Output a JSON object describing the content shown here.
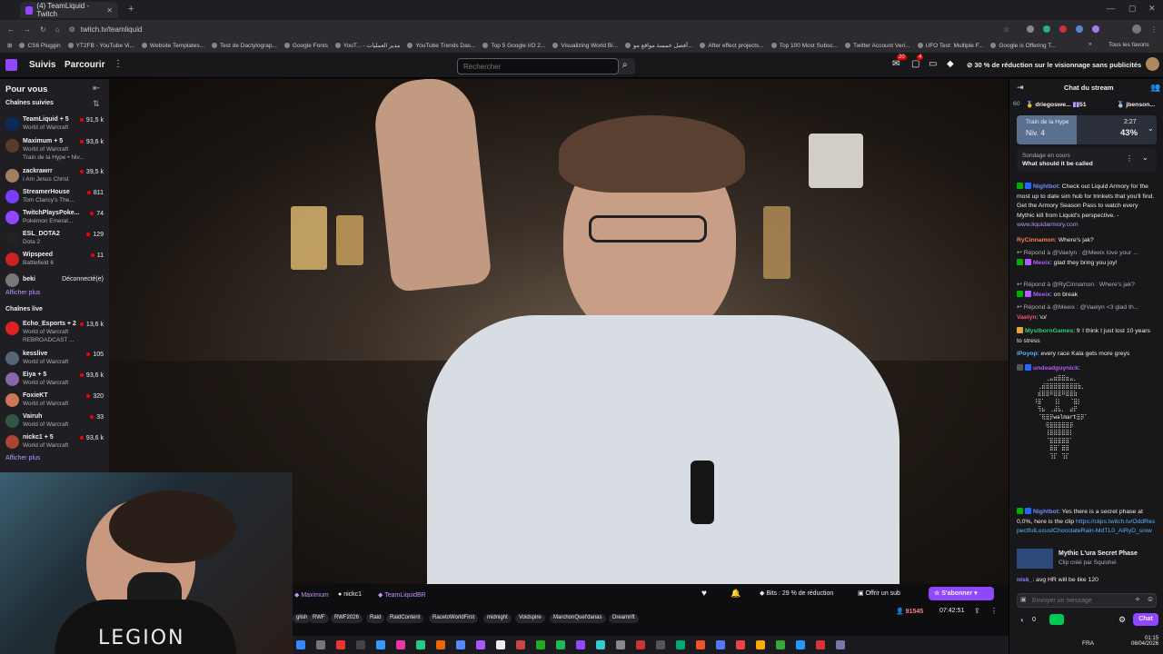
{
  "browser": {
    "tab_title": "(4) TeamLiquid - Twitch",
    "url": "twitch.tv/teamliquid",
    "bookmarks": [
      "CS6 Pluggin",
      "YT2FB - YouTube Vi...",
      "Website Templates...",
      "Test de Dactylograp...",
      "Google Fonts",
      "YouT... - مدير العمليات",
      "YouTube Trends Das...",
      "Top 5 Google I/O 2...",
      "Visualizing World Bi...",
      "أفضل خمسة مواقع مو...",
      "After effect projects...",
      "Top 100 Most Subsc...",
      "Twitter Account Veri...",
      "UFO Test: Multiple F...",
      "Google is Offering T..."
    ],
    "all_favorites": "Tous les favoris"
  },
  "nav": {
    "suivis": "Suivis",
    "parcourir": "Parcourir",
    "search_placeholder": "Rechercher",
    "notif_count1": "20",
    "notif_count2": "4",
    "promo": "30 % de réduction sur le visionnage sans publicités"
  },
  "sidebar": {
    "pour_vous": "Pour vous",
    "followed_heading": "Chaînes suivies",
    "followed": [
      {
        "name": "TeamLiquid + 5",
        "game": "World of Warcraft",
        "viewers": "91,5 k",
        "color": "#0a2a5a"
      },
      {
        "name": "Maximum + 5",
        "game": "World of Warcraft",
        "extra": "Train de la Hype • Niv...",
        "viewers": "93,6 k",
        "color": "#5a3a2a"
      },
      {
        "name": "zackrawrr",
        "game": "I Am Jesus Christ",
        "viewers": "39,5 k",
        "color": "#a08060"
      },
      {
        "name": "StreamerHouse",
        "game": "Tom Clancy's The...",
        "viewers": "811",
        "color": "#7a3cff"
      },
      {
        "name": "TwitchPlaysPoke...",
        "game": "Pokémon Emeral...",
        "viewers": "74",
        "color": "#9146ff"
      },
      {
        "name": "ESL_DOTA2",
        "game": "Dota 2",
        "viewers": "129",
        "color": "#222222"
      },
      {
        "name": "Wipspeed",
        "game": "Battlefield 6",
        "viewers": "11",
        "color": "#cc2222"
      },
      {
        "name": "beki",
        "status": "Déconnecté(e)",
        "color": "#777777"
      }
    ],
    "show_more_1": "Afficher plus",
    "live_heading": "Chaînes live",
    "live": [
      {
        "name": "Echo_Esports + 2",
        "game": "World of Warcraft",
        "extra": "REBROADCAST ...",
        "viewers": "13,6 k",
        "color": "#dd2222"
      },
      {
        "name": "kesslive",
        "game": "World of Warcraft",
        "viewers": "105",
        "color": "#556677"
      },
      {
        "name": "Eiya + 5",
        "game": "World of Warcraft",
        "viewers": "93,6 k",
        "color": "#8866aa"
      },
      {
        "name": "FoxieKT",
        "game": "World of Warcraft",
        "viewers": "320",
        "color": "#cc7755"
      },
      {
        "name": "Vairuh",
        "game": "World of Warcraft",
        "viewers": "33",
        "color": "#335544"
      },
      {
        "name": "nickc1 + 5",
        "game": "World of Warcraft",
        "viewers": "93,6 k",
        "color": "#aa4433"
      }
    ],
    "show_more_2": "Afficher plus"
  },
  "webcam": {
    "logo_text": "LEGION"
  },
  "stream": {
    "collab": [
      "Maximum",
      "nickc1",
      "TeamLiquidBR"
    ],
    "tags": [
      "glish",
      "RWF",
      "RWF2026",
      "Raid",
      "RaidContent",
      "RacetoWorldFirst",
      "midnight",
      "Voidspire",
      "MarchonQuel'danas",
      "Dreamrift"
    ],
    "bits": "Bits : 29 % de réduction",
    "gift": "Offrir un sub",
    "subscribe": "S'abonner",
    "viewers": "91545",
    "uptime": "07:42:51"
  },
  "chat": {
    "title": "Chat du stream",
    "top_count": "60",
    "top_users": [
      {
        "name": "driegoswe...",
        "count": "51"
      },
      {
        "name": "jbenson..."
      }
    ],
    "hype": {
      "label": "Train de la Hype",
      "level": "Niv. 4",
      "time": "2:27",
      "percent": "43%"
    },
    "poll": {
      "label": "Sondage en cours",
      "question": "What should it be called"
    },
    "messages": [
      {
        "user": "Nightbot",
        "color": "#6d8cff",
        "text": "Check out Liquid Armory for the most up to date sim hub for trinkets that you'll find. Get the Armory Season Pass to watch every Mythic kill from Liquid's perspective. - ",
        "link": "www.liquidarmory.com"
      },
      {
        "user": "RyCinnamon",
        "color": "#ff7f50",
        "text": "Where's jak?"
      },
      {
        "reply": "Répond à @Vaelyn : @Meeix love your ...",
        "user": "Meeix",
        "color": "#b05cff",
        "text": "glad they bring you joy!"
      },
      {
        "reply": "Répond à @RyCinnamon : Where's jak?",
        "user": "Meeix",
        "color": "#b05cff",
        "text": "on break"
      },
      {
        "reply": "Répond à @Meeix : @Vaelyn <3 glad th...",
        "user": "Vaelyn",
        "color": "#ff4f6e",
        "text": "\\o/"
      },
      {
        "user": "MystbornGames",
        "color": "#2ecc71",
        "text": "fr I think I just lost 10 years to stress"
      },
      {
        "user": "iPoyop",
        "color": "#5ab4ff",
        "text": "every race Kala gets more greys"
      },
      {
        "user": "undeadguynick",
        "color": "#b05cff",
        "text": ""
      },
      {
        "user": "Nightbot",
        "color": "#6d8cff",
        "text": "Yes there is a secret phase at 0,0%, here is the clip ",
        "link": "https://clips.twitch.tv/OddRespectfulLocustChocolateRain-MdTL0_AiRyD_srxw"
      },
      {
        "user": "nisk_",
        "color": "#8a8aff",
        "text": "avg HR will be like 120"
      }
    ],
    "ascii_art": "⠀⠀⠀⠀⢀⣤⣶⣿⣿⣶⣤⡀⠀\n⠀⠀⢀⣾⣿⣿⣿⣿⣿⣿⣿⣿⣷⡀\n⠀⠀⣾⣿⣿⠿⣿⣿⠿⣿⣿⣷⠀\n⠀⠸⣿⠁⠀⠀⢸⡇⠀⠀⠈⣿⡇\n⠀⠀⢻⣦⠀⢀⣼⣧⡀⠀⣴⡟⠀\n⠀⠀⠈⢿⣿⡿walmart⣿⡿⠁\n⠀⠀⠀⠀⢿⣿⣿⣿⣿⣿⡿⠀⠀\n⠀⠀⠀⠀⢸⣿⣿⣿⣿⣿⡇⠀⠀\n⠀⠀⠀⠀⠈⣿⣿⣿⣿⣿⠁⠀⠀\n⠀⠀⠀⠀⠀⣿⣿⠁⣿⣿⠀⠀⠀\n⠀⠀⠀⠀⠀⢹⡏⠀⢹⡏⠀⠀⠀",
    "clip": {
      "title": "Mythic L'ura Secret Phase",
      "by": "Clip créé par Squishei"
    },
    "input_placeholder": "Envoyer un message",
    "points": "0",
    "send": "Chat"
  },
  "system": {
    "lang": "FRA",
    "time": "01:15",
    "date": "06/04/2026"
  }
}
